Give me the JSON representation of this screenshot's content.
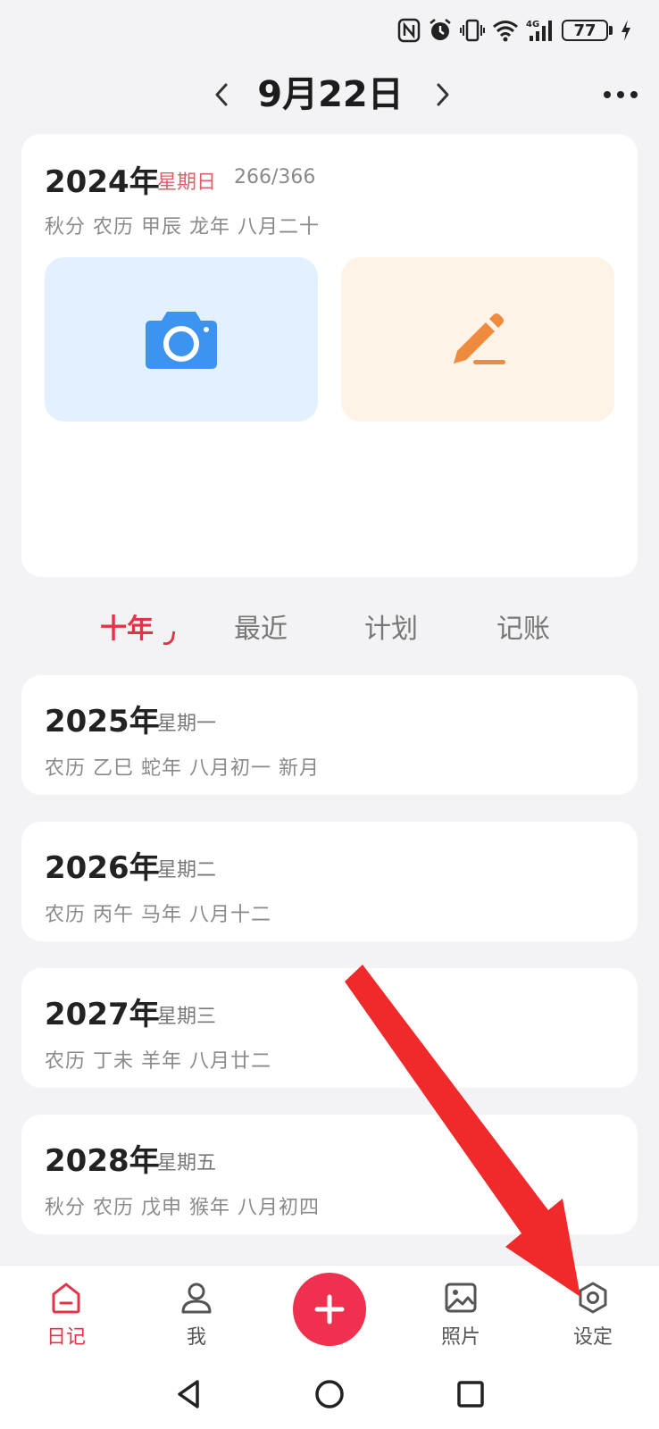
{
  "status_bar": {
    "battery_level": "77"
  },
  "header": {
    "date_title": "9月22日"
  },
  "today_card": {
    "year": "2024年",
    "weekday": "星期日",
    "day_progress": "266/366",
    "lunar": "秋分 农历  甲辰 龙年 八月二十"
  },
  "tabs": [
    {
      "label": "十年",
      "active": true
    },
    {
      "label": "最近",
      "active": false
    },
    {
      "label": "计划",
      "active": false
    },
    {
      "label": "记账",
      "active": false
    }
  ],
  "year_entries": [
    {
      "year": "2025年",
      "weekday": "星期一",
      "lunar": "农历  乙巳 蛇年 八月初一 新月"
    },
    {
      "year": "2026年",
      "weekday": "星期二",
      "lunar": "农历  丙午 马年 八月十二"
    },
    {
      "year": "2027年",
      "weekday": "星期三",
      "lunar": "农历  丁未 羊年 八月廿二"
    },
    {
      "year": "2028年",
      "weekday": "星期五",
      "lunar": "秋分 农历  戊申 猴年 八月初四"
    }
  ],
  "bottom_nav": {
    "diary": "日记",
    "me": "我",
    "photos": "照片",
    "settings": "设定"
  },
  "colors": {
    "accent": "#e23448",
    "fab": "#f0304f",
    "photo_tile_bg": "#e2f1fd",
    "note_tile_bg": "#fff2e6",
    "camera_blue": "#3d93f0",
    "pencil_orange": "#f08a3c",
    "annotation_red": "#f02a2a"
  },
  "icons": {
    "photo_tile": "camera-icon",
    "note_tile": "pencil-icon",
    "fab": "plus-icon",
    "settings": "gear-icon"
  }
}
